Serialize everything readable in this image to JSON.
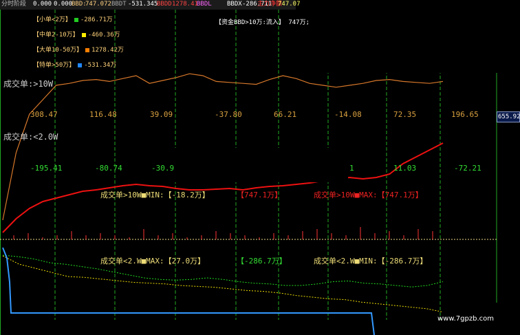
{
  "header": {
    "period": "分时阶段",
    "v1": "0.000",
    "v2": "0.000",
    "bbd_label": "BBD:",
    "bbd_value": "747.072",
    "bbdt_label": "BBDT",
    "bbdt_value": "-531.345",
    "bbdd_label": "BBDD",
    "bbdd_value": "1278.41",
    "bbdl_label": "BBDL",
    "bbdx_label": "BBDX",
    "bbdx_value": "-286.711",
    "main_label": "主力净额",
    "main_value": "747.07"
  },
  "legend": [
    {
      "label": "【小单<2万】",
      "value": "-286.71万",
      "color": "#22cc22"
    },
    {
      "label": "【中单2-10万】",
      "value": "-460.36万",
      "color": "#ffee00"
    },
    {
      "label": "【大单10-50万】",
      "value": "1278.42万",
      "color": "#ff7f00"
    },
    {
      "label": "【特单>50万】",
      "value": "-531.34万",
      "color": "#2288ff"
    }
  ],
  "fund_note": "【资金BBD>10万:流入】 747万;",
  "right_axis_value": "655.925",
  "label_big_order": "成交单:>10W",
  "label_small_order": "成交单:<2.0W",
  "row1_values": [
    "308.47",
    "116.48",
    "39.09",
    "-37.80",
    "66.21",
    "-14.08",
    "72.35",
    "196.65"
  ],
  "row2_values": [
    "-195.41",
    "-80.74",
    "-30.9",
    "1",
    "11.03",
    "-72.21"
  ],
  "stats": {
    "big_min_label": "成交单>10W■MIN:【-18.2万】",
    "big_mid_value": "【747.1万】",
    "big_max_label": "成交单>10W■MAX:【747.1万】",
    "small_max_label": "成交单<2.W■MAX:【27.0万】",
    "small_mid_value": "【-286.7万】",
    "small_min_label": "成交单<2.W■MIN:【-286.7万】"
  },
  "watermark": "www.7gpzb.com",
  "colors": {
    "orange": "#d8782a",
    "red": "#ee1111",
    "green": "#22dd22",
    "yellow": "#eedd00",
    "blue": "#3399ff",
    "grid": "#22aa22",
    "stat_text": "#eedd77",
    "stat_red": "#ee2222"
  },
  "chart_data": {
    "type": "line",
    "title": "",
    "xlabel": "",
    "ylabel": "",
    "grid": true,
    "series": [
      {
        "name": "成交单:>10W",
        "color": "#d8782a",
        "values": [
          0.2,
          0.9,
          1.3,
          1.45,
          1.6,
          1.62,
          1.65,
          1.66,
          1.64,
          1.67,
          1.7,
          1.62,
          1.65,
          1.68,
          1.72,
          1.7,
          1.64,
          1.63,
          1.62,
          1.61,
          1.66,
          1.7,
          1.67,
          1.62,
          1.6,
          1.58,
          1.6,
          1.62,
          1.65,
          1.66,
          1.64,
          1.63,
          1.62,
          1.64
        ]
      },
      {
        "name": "成交单:<2.0W",
        "color": "#ee1111",
        "values": [
          0.1,
          0.3,
          0.45,
          0.55,
          0.6,
          0.65,
          0.7,
          0.72,
          0.75,
          0.78,
          0.8,
          0.78,
          0.77,
          0.74,
          0.72,
          0.72,
          0.73,
          0.74,
          0.72,
          0.75,
          0.77,
          0.78,
          0.8,
          0.82,
          0.85,
          0.88,
          0.9,
          0.88,
          0.9,
          0.95,
          1.1,
          1.2,
          1.3,
          1.4
        ]
      },
      {
        "name": "",
        "color": "#eedd00",
        "values": [
          -0.1,
          -0.2,
          -0.25,
          -0.3,
          -0.35,
          -0.36,
          -0.38,
          -0.4,
          -0.42,
          -0.43,
          -0.44,
          -0.46,
          -0.47,
          -0.48,
          -0.5,
          -0.52,
          -0.53,
          -0.55,
          -0.58,
          -0.6,
          -0.62,
          -0.63,
          -0.66,
          -0.68,
          -0.7,
          -0.72,
          -0.74,
          -0.78
        ]
      },
      {
        "name": "",
        "color": "#22cc22",
        "values": [
          -0.1,
          -0.12,
          -0.15,
          -0.2,
          -0.22,
          -0.25,
          -0.28,
          -0.32,
          -0.36,
          -0.4,
          -0.42,
          -0.43,
          -0.42,
          -0.4,
          -0.42,
          -0.45,
          -0.47,
          -0.48,
          -0.5,
          -0.5,
          -0.48,
          -0.45,
          -0.44,
          -0.47,
          -0.48,
          -0.5,
          -0.52,
          -0.5,
          -0.45
        ]
      }
    ],
    "bars": [
      0.02,
      0.03,
      0.01,
      0.02,
      0.04,
      0.02,
      0.03,
      0.02,
      0.01,
      0.05,
      0.02,
      0.03,
      0.01,
      0.02,
      0.04,
      0.03,
      0.02,
      0.01,
      0.03,
      0.02,
      0.04,
      0.05,
      0.03,
      0.02,
      0.06,
      0.03,
      0.04,
      0.02,
      0.05,
      0.04
    ]
  }
}
